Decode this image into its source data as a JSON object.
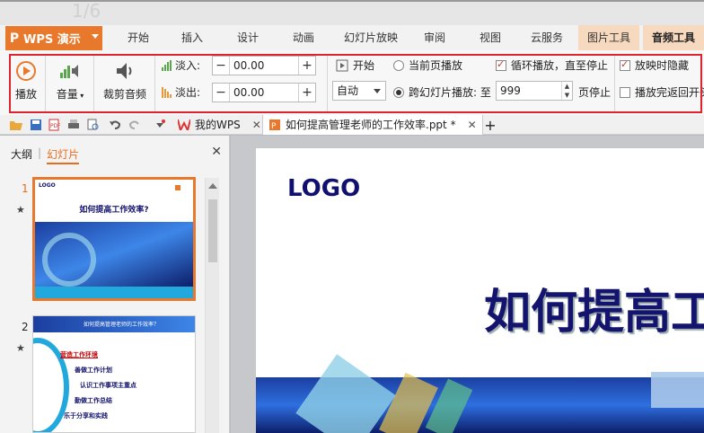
{
  "app": {
    "name": "WPS 演示",
    "logo_glyph": "P",
    "accent_color": "#e8792c"
  },
  "tabs": [
    {
      "label": "开始"
    },
    {
      "label": "插入"
    },
    {
      "label": "设计"
    },
    {
      "label": "动画"
    },
    {
      "label": "幻灯片放映"
    },
    {
      "label": "审阅"
    },
    {
      "label": "视图"
    },
    {
      "label": "云服务"
    },
    {
      "label": "图片工具"
    },
    {
      "label": "音频工具"
    }
  ],
  "ribbon": {
    "play_label": "播放",
    "volume_label": "音量",
    "trim_label": "裁剪音频",
    "fade_in_label": "淡入:",
    "fade_in_value": "00.00",
    "fade_out_label": "淡出:",
    "fade_out_value": "00.00",
    "start_label": "开始",
    "start_mode": "自动",
    "current_page_label": "当前页播放",
    "cross_slide_label": "跨幻灯片播放: 至",
    "cross_slide_value": "999",
    "page_stop_label": "页停止",
    "loop_label": "循环播放，直至停止",
    "hide_label": "放映时隐藏",
    "rewind_label": "播放完返回开头"
  },
  "doc_tabs": [
    {
      "label": "我的WPS"
    },
    {
      "label": "如何提高管理老师的工作效率.ppt *"
    }
  ],
  "panel": {
    "outline_label": "大纲",
    "slides_label": "幻灯片",
    "slide1_num": "1",
    "slide2_num": "2",
    "thumb1_logo": "LOGO",
    "thumb1_title": "如何提高工作效率?",
    "thumb2_header": "如何提高管理老师的工作效率？",
    "thumb2_items": [
      "营造工作环境",
      "善做工作计划",
      "认识工作事项主重点",
      "勤做工作总结",
      "乐于分享和实践"
    ]
  },
  "slide": {
    "logo": "LOGO",
    "title": "如何提高工"
  }
}
